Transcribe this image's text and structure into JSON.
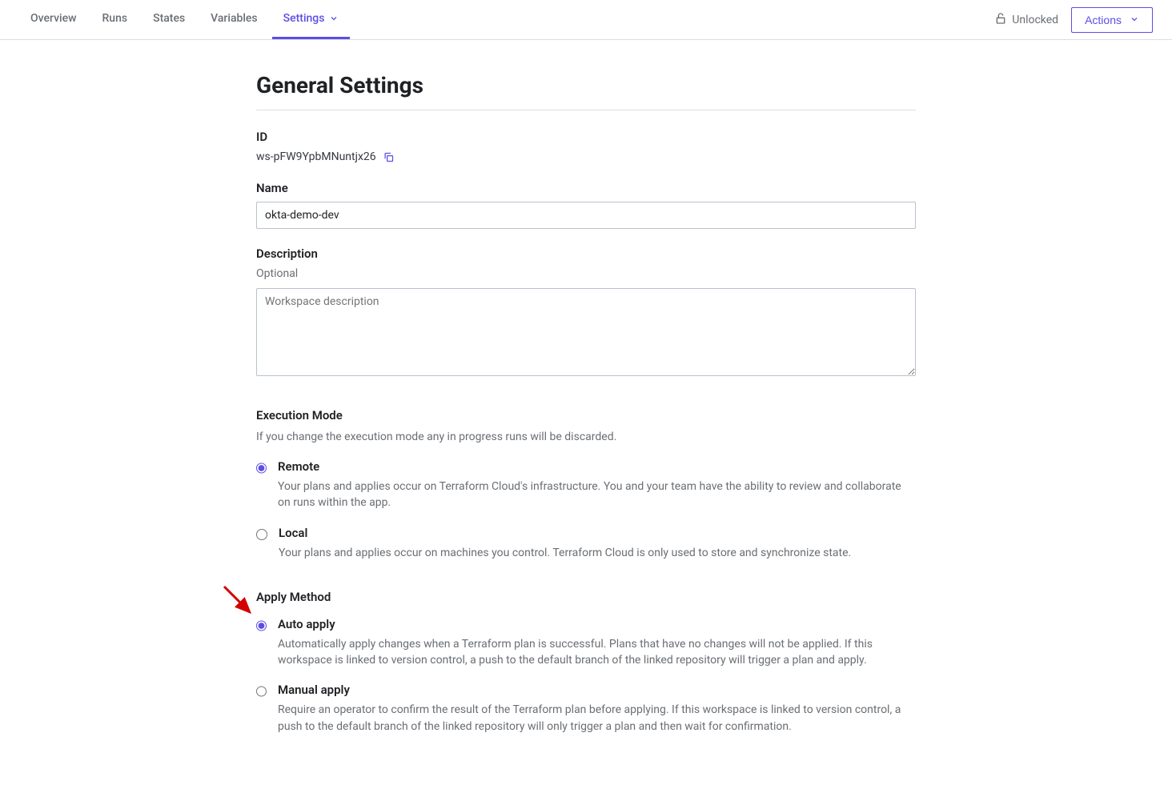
{
  "tabs": {
    "overview": "Overview",
    "runs": "Runs",
    "states": "States",
    "variables": "Variables",
    "settings": "Settings"
  },
  "topright": {
    "lock_status": "Unlocked",
    "actions_label": "Actions"
  },
  "page": {
    "title": "General Settings"
  },
  "id_field": {
    "label": "ID",
    "value": "ws-pFW9YpbMNuntjx26"
  },
  "name_field": {
    "label": "Name",
    "value": "okta-demo-dev"
  },
  "description_field": {
    "label": "Description",
    "hint": "Optional",
    "placeholder": "Workspace description",
    "value": ""
  },
  "execution_mode": {
    "title": "Execution Mode",
    "hint": "If you change the execution mode any in progress runs will be discarded.",
    "remote": {
      "title": "Remote",
      "desc": "Your plans and applies occur on Terraform Cloud's infrastructure. You and your team have the ability to review and collaborate on runs within the app."
    },
    "local": {
      "title": "Local",
      "desc": "Your plans and applies occur on machines you control. Terraform Cloud is only used to store and synchronize state."
    }
  },
  "apply_method": {
    "title": "Apply Method",
    "auto": {
      "title": "Auto apply",
      "desc": "Automatically apply changes when a Terraform plan is successful. Plans that have no changes will not be applied. If this workspace is linked to version control, a push to the default branch of the linked repository will trigger a plan and apply."
    },
    "manual": {
      "title": "Manual apply",
      "desc": "Require an operator to confirm the result of the Terraform plan before applying. If this workspace is linked to version control, a push to the default branch of the linked repository will only trigger a plan and then wait for confirmation."
    }
  }
}
